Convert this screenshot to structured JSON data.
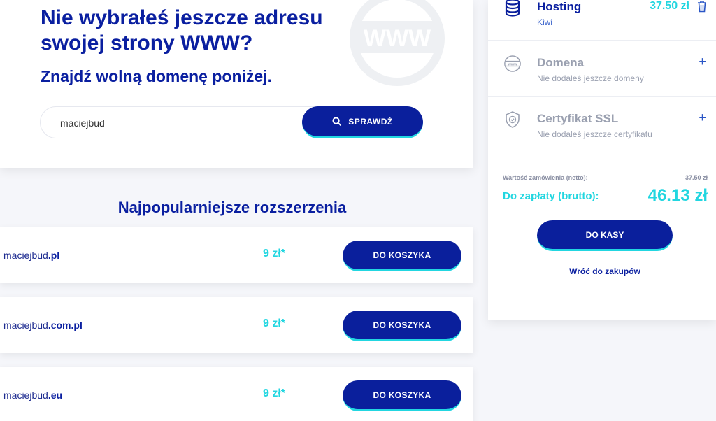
{
  "hero": {
    "headline": "Nie wybrałeś jeszcze adresu swojej strony WWW?",
    "subhead": "Znajdź wolną domenę poniżej.",
    "graphic_text": "WWW"
  },
  "search": {
    "value": "maciejbud",
    "button_label": "SPRAWDŹ"
  },
  "popular": {
    "title": "Najpopularniejsze rozszerzenia",
    "items": [
      {
        "name": "maciejbud",
        "ext": ".pl",
        "price": "9 zł*",
        "button": "DO KOSZYKA"
      },
      {
        "name": "maciejbud",
        "ext": ".com.pl",
        "price": "9 zł*",
        "button": "DO KOSZYKA"
      },
      {
        "name": "maciejbud",
        "ext": ".eu",
        "price": "9 zł*",
        "button": "DO KOSZYKA"
      }
    ]
  },
  "cart": {
    "hosting": {
      "title": "Hosting",
      "sub": "Kiwi",
      "price": "37.50 zł"
    },
    "domain": {
      "title": "Domena",
      "sub": "Nie dodałeś jeszcze domeny",
      "plus": "+"
    },
    "ssl": {
      "title": "Certyfikat SSL",
      "sub": "Nie dodałeś jeszcze certyfikatu",
      "plus": "+"
    },
    "net_label": "Wartość zamówienia (netto):",
    "net_value": "37.50 zł",
    "gross_label": "Do zapłaty (brutto):",
    "gross_value": "46.13 zł",
    "checkout_label": "DO KASY",
    "back_label": "Wróć do zakupów"
  },
  "colors": {
    "primary": "#0a1f9c",
    "accent": "#22d6e0"
  }
}
